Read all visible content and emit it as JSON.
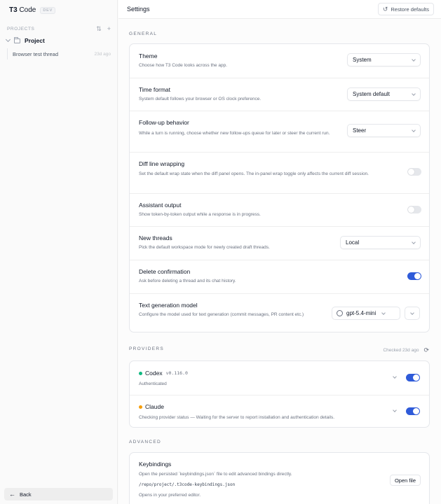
{
  "sidebar": {
    "brand": "T3",
    "brand_suffix": "Code",
    "badge": "DEV",
    "projects_label": "PROJECTS",
    "project_name": "Project",
    "thread_name": "Browser test thread",
    "thread_age": "23d ago",
    "back_label": "Back"
  },
  "header": {
    "title": "Settings",
    "restore_label": "Restore defaults"
  },
  "general": {
    "label": "GENERAL",
    "theme": {
      "title": "Theme",
      "desc": "Choose how T3 Code looks across the app.",
      "value": "System"
    },
    "time_format": {
      "title": "Time format",
      "desc": "System default follows your browser or OS clock preference.",
      "value": "System default"
    },
    "follow_up": {
      "title": "Follow-up behavior",
      "desc": "While a turn is running, choose whether new follow-ups queue for later or steer the current run.",
      "value": "Steer"
    },
    "diff_wrap": {
      "title": "Diff line wrapping",
      "desc": "Set the default wrap state when the diff panel opens. The in-panel wrap toggle only affects the current diff session.",
      "enabled": false
    },
    "assistant_output": {
      "title": "Assistant output",
      "desc": "Show token-by-token output while a response is in progress.",
      "enabled": false
    },
    "new_threads": {
      "title": "New threads",
      "desc": "Pick the default workspace mode for newly created draft threads.",
      "value": "Local"
    },
    "delete_confirm": {
      "title": "Delete confirmation",
      "desc": "Ask before deleting a thread and its chat history.",
      "enabled": true
    },
    "text_model": {
      "title": "Text generation model",
      "desc": "Configure the model used for text generation (commit messages, PR content etc.)",
      "value": "gpt-5.4-mini"
    }
  },
  "providers": {
    "label": "PROVIDERS",
    "checked": "Checked 23d ago",
    "codex": {
      "name": "Codex",
      "version": "v0.116.0",
      "status": "Authenticated",
      "dot_color": "#10b981",
      "enabled": true
    },
    "claude": {
      "name": "Claude",
      "status": "Checking provider status — Waiting for the server to report installation and authentication details.",
      "dot_color": "#f59e0b",
      "enabled": true
    }
  },
  "advanced": {
    "label": "ADVANCED",
    "keybindings": {
      "title": "Keybindings",
      "desc": "Open the persisted `keybindings.json` file to edit advanced bindings directly.",
      "path": "/repo/project/.t3code-keybindings.json",
      "note": "Opens in your preferred editor.",
      "open_label": "Open file"
    }
  },
  "colors": {
    "accent": "#2f5bd9",
    "toggle_off": "#e5e7eb"
  }
}
